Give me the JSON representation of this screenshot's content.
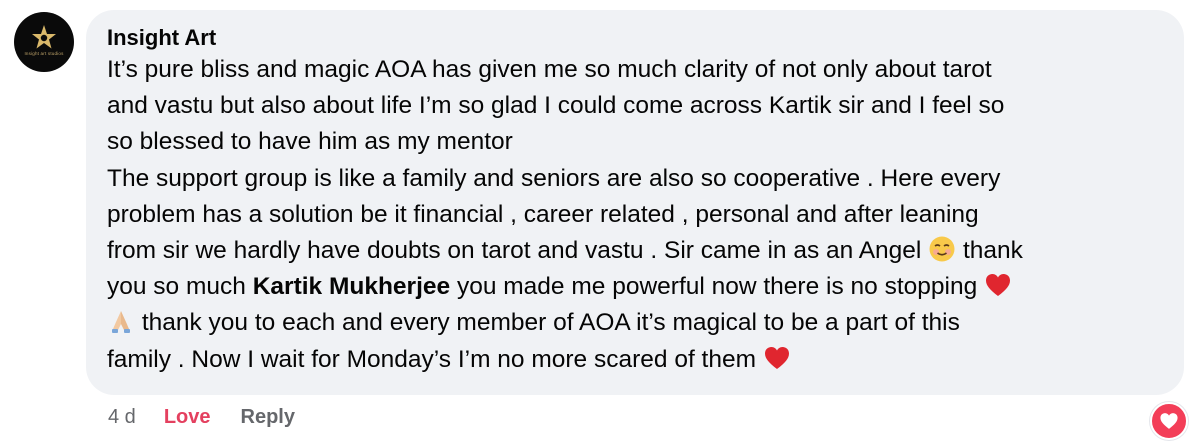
{
  "comment": {
    "author": "Insight Art",
    "avatar_logo_text": "Insight art studios",
    "lines": [
      "It’s pure bliss and magic AOA has given me so much clarity of not only about tarot",
      "and vastu but also about life I’m so glad I could come across Kartik sir and I feel so",
      "so blessed to have him as my mentor",
      "The support group is like a family and seniors are also so cooperative . Here every",
      "problem has a solution be it financial , career related , personal and after leaning",
      "from sir we hardly have doubts on tarot and vastu . Sir came in as an Angel",
      "thank",
      "you so much",
      "Kartik Mukherjee",
      "you made me powerful now there is no stopping",
      "thank you to each and every member of AOA it’s magical to be a part of this",
      "family . Now I wait for Monday’s I’m no more scared of them"
    ],
    "emojis": {
      "smile": "smiling-face-icon",
      "heart": "red-heart-icon",
      "pray": "folded-hands-icon"
    }
  },
  "actions": {
    "time": "4 d",
    "love_label": "Love",
    "reply_label": "Reply"
  },
  "reaction": {
    "icon": "heart-reaction-icon",
    "color": "#f33e58"
  }
}
